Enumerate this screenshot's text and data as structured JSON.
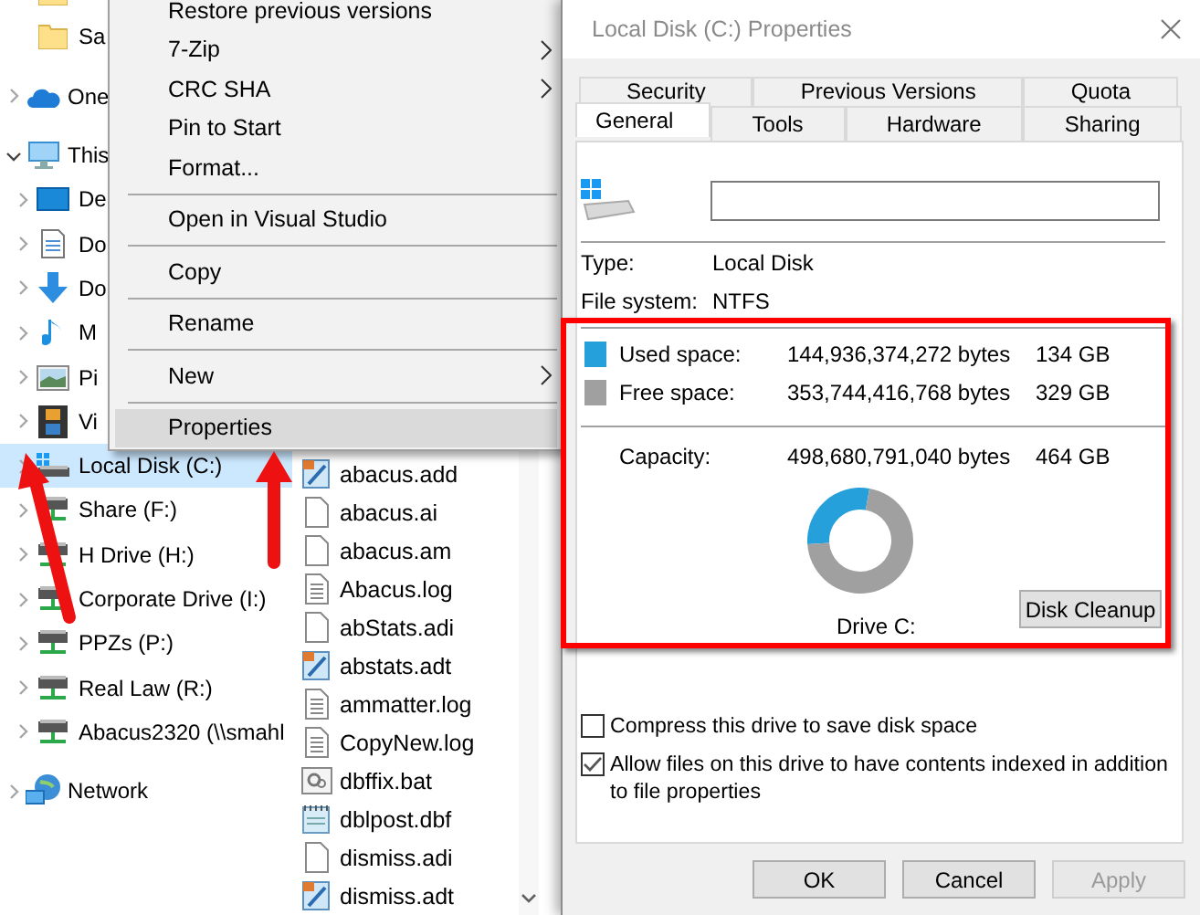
{
  "navigation": {
    "items": [
      {
        "kind": "folder"
      },
      {
        "kind": "folder",
        "label": "Sa"
      },
      {
        "kind": "cloud",
        "label": "One",
        "expanded": false
      },
      {
        "kind": "pc",
        "label": "This",
        "expanded": true,
        "children": [
          {
            "kind": "desktop",
            "label": "De",
            "expanded": false,
            "selected": false
          },
          {
            "kind": "documents",
            "label": "Do",
            "expanded": false,
            "selected": false
          },
          {
            "kind": "downloads",
            "label": "Do",
            "expanded": false,
            "selected": false
          },
          {
            "kind": "music",
            "label": "M",
            "expanded": false,
            "selected": false
          },
          {
            "kind": "pictures",
            "label": "Pi",
            "expanded": false,
            "selected": false
          },
          {
            "kind": "videos",
            "label": "Vi",
            "expanded": false,
            "selected": false
          },
          {
            "kind": "local-drive",
            "label": "Local Disk (C:)",
            "expanded": false,
            "selected": true
          },
          {
            "kind": "network-drive",
            "label": "Share (F:)",
            "expanded": false,
            "selected": false
          },
          {
            "kind": "network-drive",
            "label": "H Drive (H:)",
            "expanded": false,
            "selected": false
          },
          {
            "kind": "network-drive",
            "label": "Corporate Drive (I:)",
            "expanded": false,
            "selected": false
          },
          {
            "kind": "network-drive",
            "label": "PPZs (P:)",
            "expanded": false,
            "selected": false
          },
          {
            "kind": "network-drive",
            "label": "Real Law (R:)",
            "expanded": false,
            "selected": false
          },
          {
            "kind": "network-drive",
            "label": "Abacus2320 (\\\\smahl",
            "expanded": false,
            "selected": false
          }
        ]
      },
      {
        "kind": "network",
        "label": "Network",
        "expanded": false
      }
    ]
  },
  "files": [
    {
      "kind": "data",
      "name": "abacus.add"
    },
    {
      "kind": "blank",
      "name": "abacus.ai"
    },
    {
      "kind": "blank",
      "name": "abacus.am"
    },
    {
      "kind": "text",
      "name": "Abacus.log"
    },
    {
      "kind": "blank",
      "name": "abStats.adi"
    },
    {
      "kind": "data",
      "name": "abstats.adt"
    },
    {
      "kind": "text",
      "name": "ammatter.log"
    },
    {
      "kind": "text",
      "name": "CopyNew.log"
    },
    {
      "kind": "batch",
      "name": "dbffix.bat"
    },
    {
      "kind": "notepad",
      "name": "dblpost.dbf"
    },
    {
      "kind": "blank",
      "name": "dismiss.adi"
    },
    {
      "kind": "data",
      "name": "dismiss.adt"
    }
  ],
  "context_menu": [
    {
      "kind": "item",
      "label": "Restore previous versions",
      "submenu": false,
      "selected": false
    },
    {
      "kind": "item",
      "label": "7-Zip",
      "submenu": true,
      "selected": false
    },
    {
      "kind": "item",
      "label": "CRC SHA",
      "submenu": true,
      "selected": false
    },
    {
      "kind": "item",
      "label": "Pin to Start",
      "submenu": false,
      "selected": false
    },
    {
      "kind": "item",
      "label": "Format...",
      "submenu": false,
      "selected": false
    },
    {
      "kind": "separator"
    },
    {
      "kind": "item",
      "label": "Open in Visual Studio",
      "submenu": false,
      "selected": false
    },
    {
      "kind": "separator"
    },
    {
      "kind": "item",
      "label": "Copy",
      "submenu": false,
      "selected": false
    },
    {
      "kind": "separator"
    },
    {
      "kind": "item",
      "label": "Rename",
      "submenu": false,
      "selected": false
    },
    {
      "kind": "separator"
    },
    {
      "kind": "item",
      "label": "New",
      "submenu": true,
      "selected": false
    },
    {
      "kind": "separator"
    },
    {
      "kind": "item",
      "label": "Properties",
      "submenu": false,
      "selected": true
    }
  ],
  "dialog": {
    "title": "Local Disk (C:) Properties",
    "tab_rows": [
      [
        {
          "label": "Security",
          "selected": false
        },
        {
          "label": "Previous Versions",
          "selected": false
        },
        {
          "label": "Quota",
          "selected": false
        }
      ],
      [
        {
          "label": "General",
          "selected": true
        },
        {
          "label": "Tools",
          "selected": false
        },
        {
          "label": "Hardware",
          "selected": false
        },
        {
          "label": "Sharing",
          "selected": false
        }
      ]
    ],
    "info": [
      {
        "label": "Type:",
        "value": "Local Disk"
      },
      {
        "label": "File system:",
        "value": "NTFS"
      }
    ],
    "space": [
      {
        "label": "Used space:",
        "bytes": "144,936,374,272 bytes",
        "size": "134 GB",
        "color": "#26a0da"
      },
      {
        "label": "Free space:",
        "bytes": "353,744,416,768 bytes",
        "size": "329 GB",
        "color": "#a0a0a0"
      }
    ],
    "capacity": {
      "label": "Capacity:",
      "bytes": "498,680,791,040 bytes",
      "size": "464 GB"
    },
    "chart_data": {
      "type": "donut",
      "values": [
        28.9,
        71.1
      ]
    },
    "drive_label": "Drive C:",
    "cleanup_button": "Disk Cleanup",
    "options": [
      {
        "label": "Compress this drive to save disk space",
        "checked": false
      },
      {
        "label": "Allow files on this drive to have contents indexed in addition to file properties",
        "checked": true
      }
    ],
    "buttons": [
      {
        "label": "OK",
        "disabled": false
      },
      {
        "label": "Cancel",
        "disabled": false
      },
      {
        "label": "Apply",
        "disabled": true
      }
    ]
  }
}
